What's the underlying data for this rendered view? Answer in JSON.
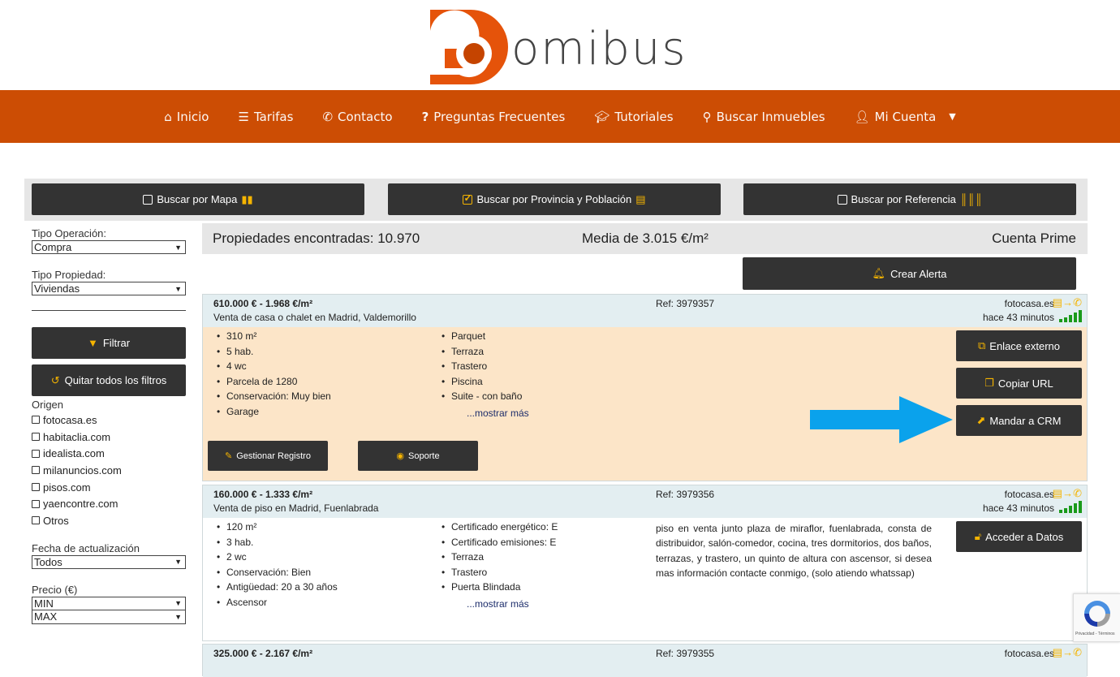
{
  "brand": {
    "name": "omibus",
    "primary_color": "#cc4d04"
  },
  "nav": {
    "items": [
      {
        "label": "Inicio",
        "icon": "home-icon"
      },
      {
        "label": "Tarifas",
        "icon": "list-icon"
      },
      {
        "label": "Contacto",
        "icon": "phone-icon"
      },
      {
        "label": "Preguntas Frecuentes",
        "icon": "question-icon"
      },
      {
        "label": "Tutoriales",
        "icon": "graduation-cap-icon"
      },
      {
        "label": "Buscar Inmuebles",
        "icon": "search-icon"
      },
      {
        "label": "Mi Cuenta",
        "icon": "user-icon"
      }
    ]
  },
  "search_modes": {
    "map": "Buscar por Mapa",
    "province": "Buscar por Provincia y Población",
    "reference": "Buscar por Referencia"
  },
  "sidebar": {
    "operation_label": "Tipo Operación:",
    "operation_value": "Compra",
    "property_label": "Tipo Propiedad:",
    "property_value": "Viviendas",
    "filter_button": "Filtrar",
    "clear_button": "Quitar todos los filtros",
    "origin_label": "Origen",
    "origins": [
      "fotocasa.es",
      "habitaclia.com",
      "idealista.com",
      "milanuncios.com",
      "pisos.com",
      "yaencontre.com",
      "Otros"
    ],
    "date_label": "Fecha de actualización",
    "date_value": "Todos",
    "price_label": "Precio (€)",
    "price_min": "MIN",
    "price_max": "MAX"
  },
  "results": {
    "found": "Propiedades encontradas: 10.970",
    "average": "Media de 3.015 €/m²",
    "account": "Cuenta Prime",
    "alert_button": "Crear Alerta"
  },
  "listings": [
    {
      "price": "610.000 € - 1.968 €/m²",
      "title": "Venta de casa o chalet en Madrid, Valdemorillo",
      "ref": "Ref: 3979357",
      "source": "fotocasa.es",
      "time": "hace 43 minutos",
      "features_left": [
        "310 m²",
        "5 hab.",
        "4 wc",
        "Parcela de 1280",
        "Conservación: Muy bien",
        "Garage"
      ],
      "features_right": [
        "Parquet",
        "Terraza",
        "Trastero",
        "Piscina",
        "Suite - con baño"
      ],
      "more": "...mostrar más",
      "buttons": {
        "external": "Enlace externo",
        "copy": "Copiar URL",
        "crm": "Mandar a CRM",
        "manage": "Gestionar Registro",
        "support": "Soporte"
      }
    },
    {
      "price": "160.000 € - 1.333 €/m²",
      "title": "Venta de piso en Madrid, Fuenlabrada",
      "ref": "Ref: 3979356",
      "source": "fotocasa.es",
      "time": "hace 43 minutos",
      "features_left": [
        "120 m²",
        "3 hab.",
        "2 wc",
        "Conservación: Bien",
        "Antigüedad: 20 a 30 años",
        "Ascensor"
      ],
      "features_right": [
        "Certificado energético: E",
        "Certificado emisiones: E",
        "Terraza",
        "Trastero",
        "Puerta Blindada"
      ],
      "more": "...mostrar más",
      "description": "piso en venta junto plaza de miraflor, fuenlabrada, consta de distribuidor, salón-comedor, cocina, tres dormitorios, dos baños, terrazas, y trastero, un quinto de altura con ascensor, si desea mas información contacte conmigo, (solo atiendo whatssap)",
      "buttons": {
        "access": "Acceder a Datos"
      }
    },
    {
      "price": "325.000 € - 2.167 €/m²",
      "ref": "Ref: 3979355",
      "source": "fotocasa.es"
    }
  ],
  "recaptcha": {
    "text": "Privacidad - Términos"
  }
}
